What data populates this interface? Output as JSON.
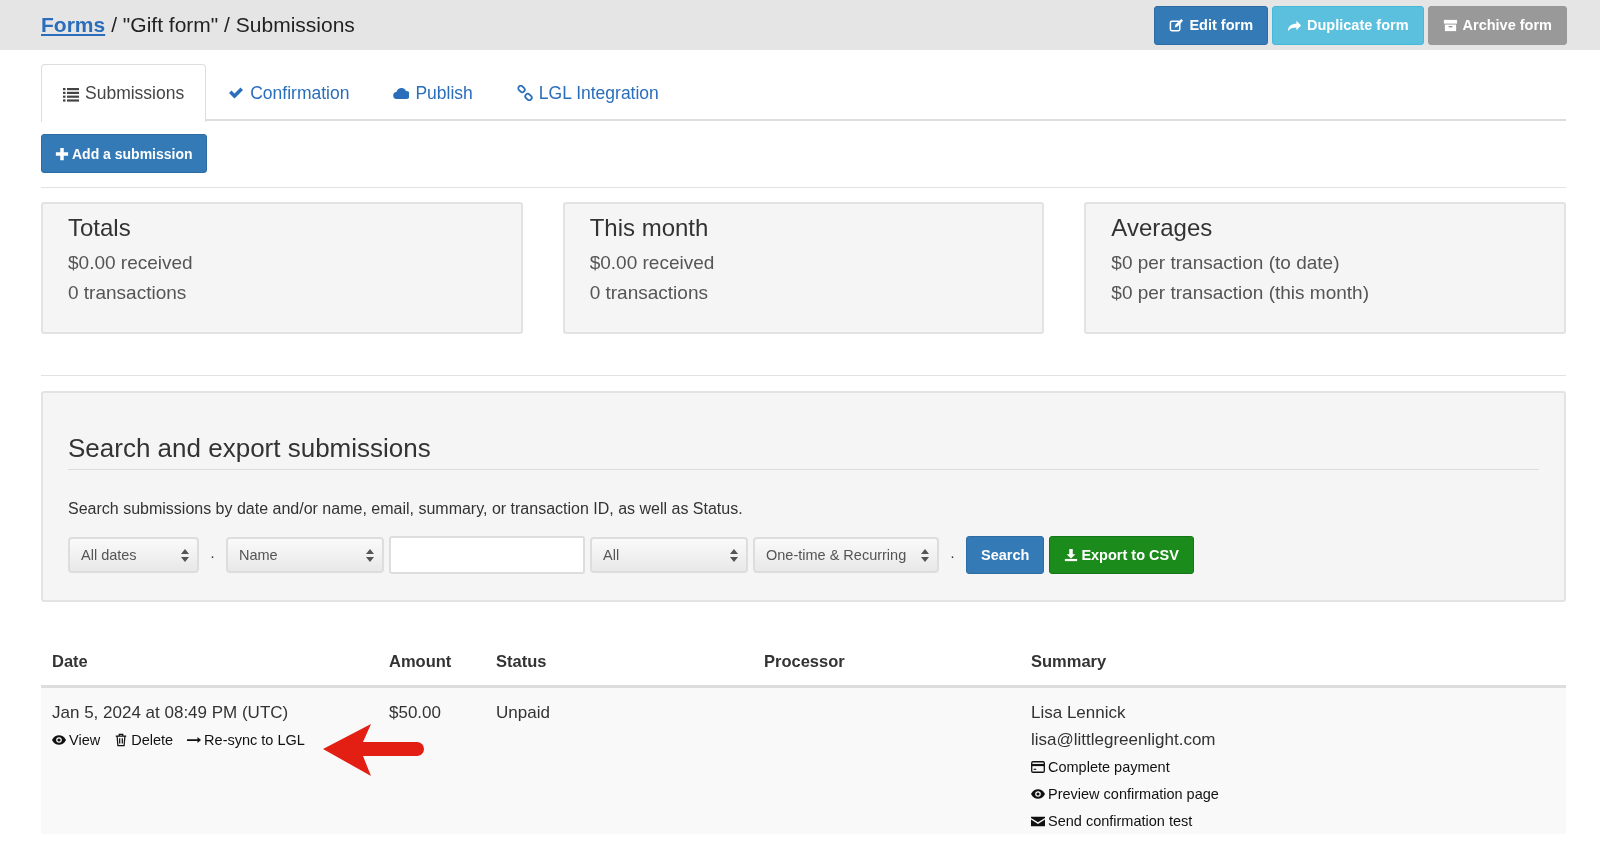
{
  "breadcrumb": {
    "link": "Forms",
    "rest": "/ \"Gift form\" / Submissions"
  },
  "header_buttons": [
    {
      "label": "Edit form",
      "kind": "primary"
    },
    {
      "label": "Duplicate form",
      "kind": "info"
    },
    {
      "label": "Archive form",
      "kind": "muted"
    }
  ],
  "tabs": [
    {
      "label": "Submissions",
      "selected": true
    },
    {
      "label": "Confirmation",
      "selected": false
    },
    {
      "label": "Publish",
      "selected": false
    },
    {
      "label": "LGL Integration",
      "selected": false
    }
  ],
  "add_button": "Add a submission",
  "stats": [
    {
      "title": "Totals",
      "lines": [
        "$0.00 received",
        "0 transactions"
      ]
    },
    {
      "title": "This month",
      "lines": [
        "$0.00 received",
        "0 transactions"
      ]
    },
    {
      "title": "Averages",
      "lines": [
        "$0 per transaction (to date)",
        "$0 per transaction (this month)"
      ]
    }
  ],
  "search": {
    "title": "Search and export submissions",
    "help": "Search submissions by date and/or name, email, summary, or transaction ID, as well as Status.",
    "filters": [
      {
        "kind": "select",
        "value": "All dates"
      },
      {
        "kind": "separator",
        "text": "·"
      },
      {
        "kind": "select",
        "value": "Name"
      },
      {
        "kind": "input"
      },
      {
        "kind": "select",
        "value": "All"
      },
      {
        "kind": "select",
        "value": "One-time & Recurring"
      },
      {
        "kind": "separator",
        "text": "·"
      }
    ],
    "search_button": "Search",
    "export_button": "Export to CSV"
  },
  "table": {
    "columns": [
      "Date",
      "Amount",
      "Status",
      "Processor",
      "Summary"
    ],
    "rows": [
      {
        "date": "Jan 5, 2024 at 08:49 PM (UTC)",
        "actions": [
          {
            "label": "View",
            "kind": "view"
          },
          {
            "label": "Delete",
            "kind": "delete"
          },
          {
            "label": "Re-sync to LGL",
            "kind": "resync"
          }
        ],
        "amount": "$50.00",
        "status": "Unpaid",
        "summary": {
          "name": "Lisa Lennick",
          "email": "lisa@littlegreenlight.com",
          "actions": [
            {
              "label": "Complete payment",
              "kind": "payment"
            },
            {
              "label": "Preview confirmation page",
              "kind": "preview"
            },
            {
              "label": "Send confirmation test",
              "kind": "email"
            }
          ]
        }
      }
    ]
  }
}
